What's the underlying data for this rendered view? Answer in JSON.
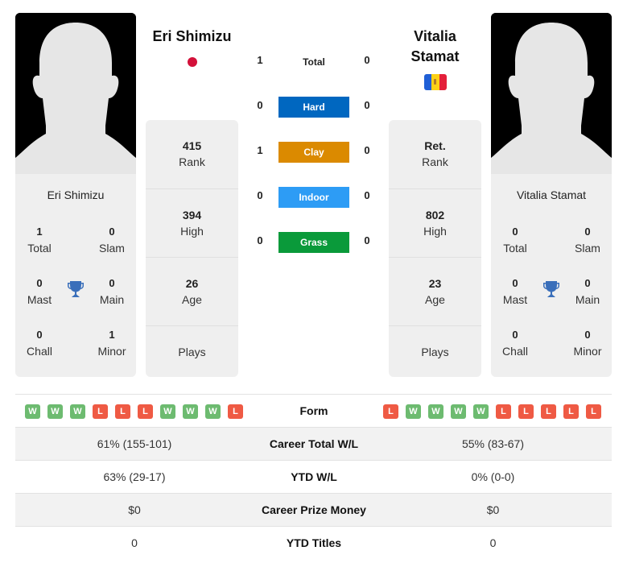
{
  "colors": {
    "hard": "#0067c0",
    "clay": "#db8a00",
    "indoor": "#2d9cf5",
    "grass": "#0a9a3a",
    "win": "#6dbb70",
    "loss": "#ef5a44",
    "trophy": "#3a6fba"
  },
  "player1": {
    "name": "Eri Shimizu",
    "flag": "japan-flag",
    "card_name": "Eri Shimizu",
    "titles": {
      "total": {
        "value": "1",
        "label": "Total"
      },
      "slam": {
        "value": "0",
        "label": "Slam"
      },
      "mast": {
        "value": "0",
        "label": "Mast"
      },
      "main": {
        "value": "0",
        "label": "Main"
      },
      "chall": {
        "value": "0",
        "label": "Chall"
      },
      "minor": {
        "value": "1",
        "label": "Minor"
      }
    },
    "info": {
      "rank": {
        "value": "415",
        "label": "Rank"
      },
      "high": {
        "value": "394",
        "label": "High"
      },
      "age": {
        "value": "26",
        "label": "Age"
      },
      "plays": {
        "value": "",
        "label": "Plays"
      }
    },
    "form": [
      "W",
      "W",
      "W",
      "L",
      "L",
      "L",
      "W",
      "W",
      "W",
      "L"
    ]
  },
  "player2": {
    "name_line1": "Vitalia",
    "name_line2": "Stamat",
    "flag": "moldova-flag",
    "card_name": "Vitalia Stamat",
    "titles": {
      "total": {
        "value": "0",
        "label": "Total"
      },
      "slam": {
        "value": "0",
        "label": "Slam"
      },
      "mast": {
        "value": "0",
        "label": "Mast"
      },
      "main": {
        "value": "0",
        "label": "Main"
      },
      "chall": {
        "value": "0",
        "label": "Chall"
      },
      "minor": {
        "value": "0",
        "label": "Minor"
      }
    },
    "info": {
      "rank": {
        "value": "Ret.",
        "label": "Rank"
      },
      "high": {
        "value": "802",
        "label": "High"
      },
      "age": {
        "value": "23",
        "label": "Age"
      },
      "plays": {
        "value": "",
        "label": "Plays"
      }
    },
    "form": [
      "L",
      "W",
      "W",
      "W",
      "W",
      "L",
      "L",
      "L",
      "L",
      "L"
    ]
  },
  "h2h": {
    "total": {
      "label": "Total",
      "p1": "1",
      "p2": "0"
    },
    "hard": {
      "label": "Hard",
      "p1": "0",
      "p2": "0"
    },
    "clay": {
      "label": "Clay",
      "p1": "1",
      "p2": "0"
    },
    "indoor": {
      "label": "Indoor",
      "p1": "0",
      "p2": "0"
    },
    "grass": {
      "label": "Grass",
      "p1": "0",
      "p2": "0"
    }
  },
  "table": {
    "form_label": "Form",
    "rows": [
      {
        "label": "Career Total W/L",
        "p1": "61% (155-101)",
        "p2": "55% (83-67)"
      },
      {
        "label": "YTD W/L",
        "p1": "63% (29-17)",
        "p2": "0% (0-0)"
      },
      {
        "label": "Career Prize Money",
        "p1": "$0",
        "p2": "$0"
      },
      {
        "label": "YTD Titles",
        "p1": "0",
        "p2": "0"
      }
    ]
  }
}
